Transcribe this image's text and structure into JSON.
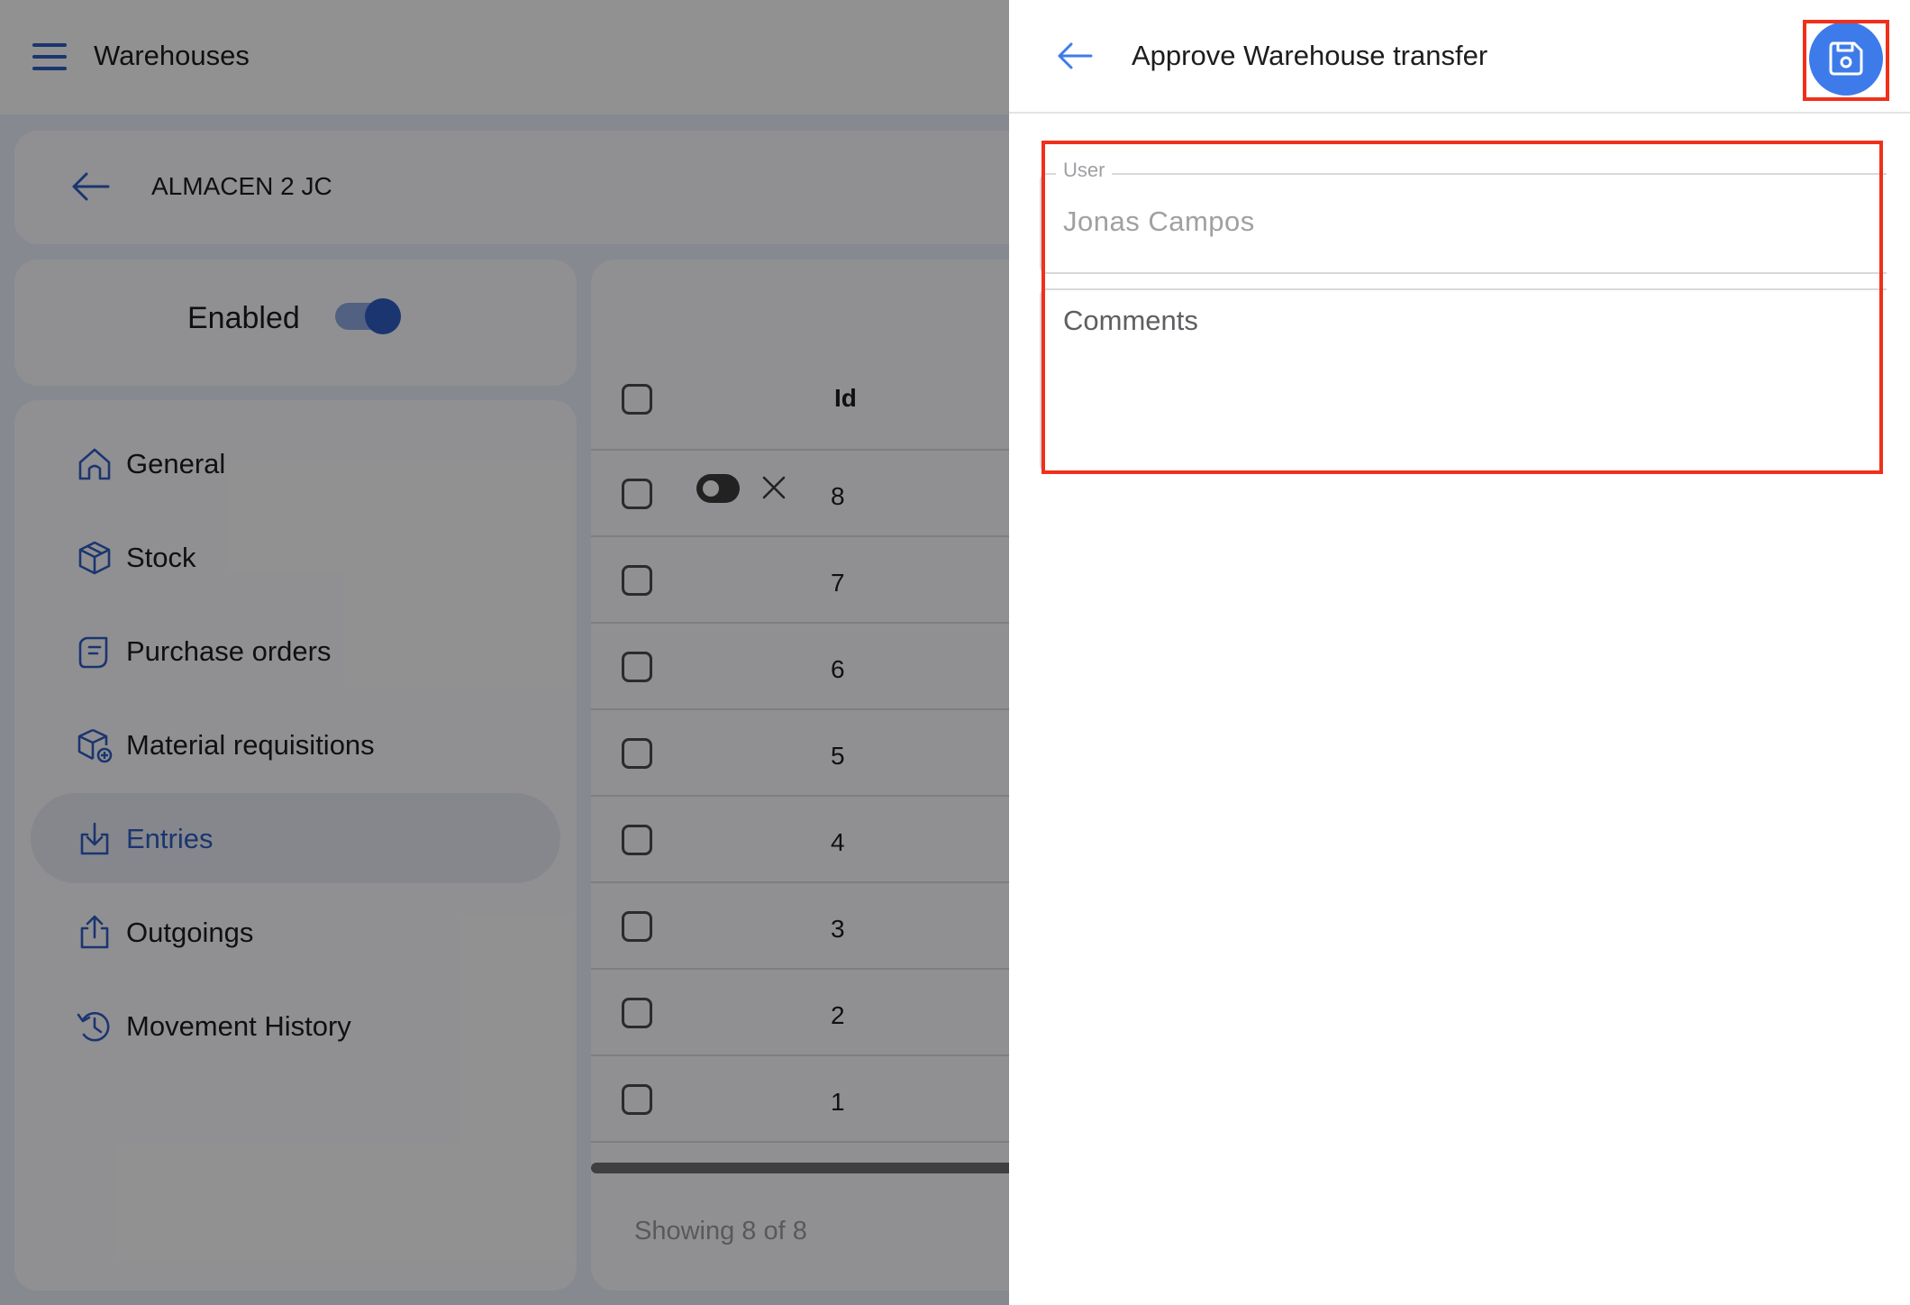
{
  "app": {
    "title": "Warehouses",
    "warehouse_name": "ALMACEN 2 JC",
    "enabled_label": "Enabled",
    "enabled": true
  },
  "nav": {
    "items": [
      {
        "label": "General",
        "icon": "home-icon"
      },
      {
        "label": "Stock",
        "icon": "box-icon"
      },
      {
        "label": "Purchase orders",
        "icon": "receipt-icon"
      },
      {
        "label": "Material requisitions",
        "icon": "box-add-icon"
      },
      {
        "label": "Entries",
        "icon": "download-icon",
        "active": true
      },
      {
        "label": "Outgoings",
        "icon": "upload-icon"
      },
      {
        "label": "Movement History",
        "icon": "history-icon"
      }
    ]
  },
  "table": {
    "header_id": "Id",
    "rows": [
      "8",
      "7",
      "6",
      "5",
      "4",
      "3",
      "2",
      "1"
    ],
    "footer": "Showing 8 of 8"
  },
  "drawer": {
    "title": "Approve Warehouse transfer",
    "save_icon": "floppy-disk-icon",
    "user_label": "User",
    "user_value": "Jonas  Campos",
    "comments_placeholder": "Comments"
  },
  "colors": {
    "accent": "#2f5cc2",
    "save_button": "#3e7bea",
    "highlight": "#f0301a"
  }
}
